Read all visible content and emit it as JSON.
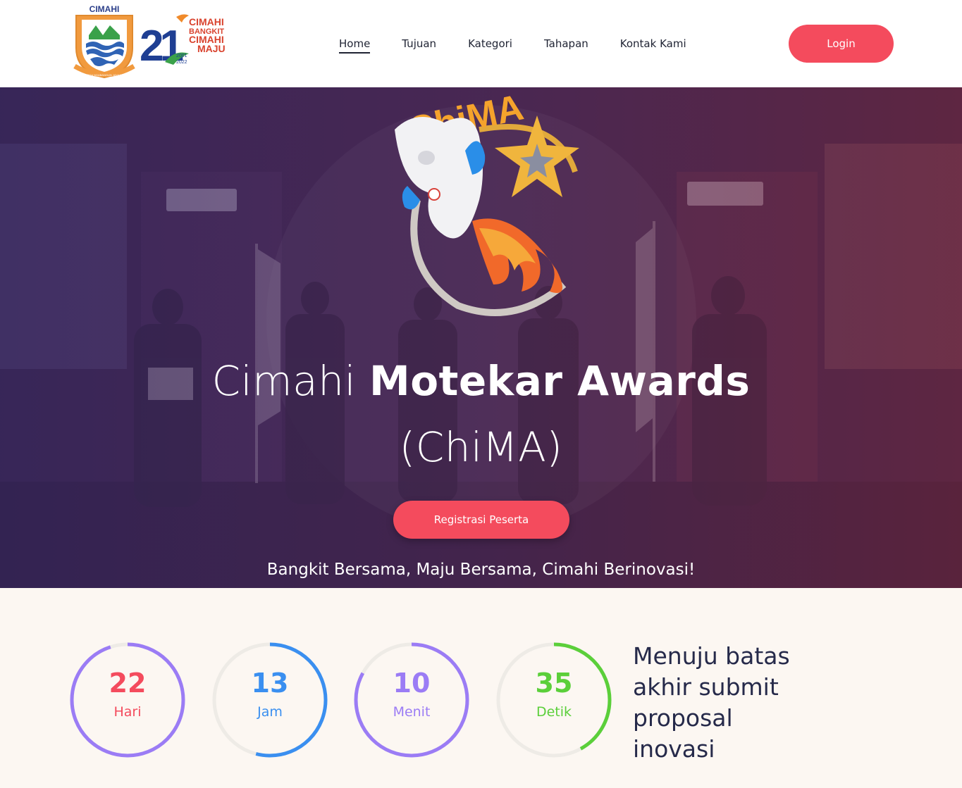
{
  "header": {
    "logo_city_name": "CIMAHI",
    "logo_motto": "SAMANGGA NGABANGUN JAYA MANDIRI",
    "anniversary_logo": {
      "number": "21",
      "lines": [
        "CIMAHI",
        "BANGKIT",
        "CIMAHI",
        "MAJU"
      ],
      "years": [
        "2001",
        "2022"
      ]
    },
    "nav": [
      {
        "label": "Home",
        "active": true
      },
      {
        "label": "Tujuan",
        "active": false
      },
      {
        "label": "Kategori",
        "active": false
      },
      {
        "label": "Tahapan",
        "active": false
      },
      {
        "label": "Kontak Kami",
        "active": false
      }
    ],
    "login_label": "Login"
  },
  "hero": {
    "logo_text": "ChiMA",
    "title_light": "Cimahi ",
    "title_bold": "Motekar Awards",
    "title_line2": "(ChiMA)",
    "register_label": "Registrasi Peserta",
    "tagline": "Bangkit Bersama, Maju Bersama, Cimahi Berinovasi!"
  },
  "countdown": {
    "items": [
      {
        "value": "22",
        "unit": "Hari",
        "color": "#f44b5d",
        "ring_color": "#9b7cf5",
        "fraction": 0.95
      },
      {
        "value": "13",
        "unit": "Jam",
        "color": "#3a8ff0",
        "ring_color": "#3a8ff0",
        "fraction": 0.54
      },
      {
        "value": "10",
        "unit": "Menit",
        "color": "#9b7cf5",
        "ring_color": "#9b7cf5",
        "fraction": 0.83
      },
      {
        "value": "35",
        "unit": "Detik",
        "color": "#5bcf3a",
        "ring_color": "#5bcf3a",
        "fraction": 0.42
      }
    ],
    "track_color": "#eeebe6",
    "deadline_text": "Menuju batas akhir submit proposal inovasi"
  }
}
